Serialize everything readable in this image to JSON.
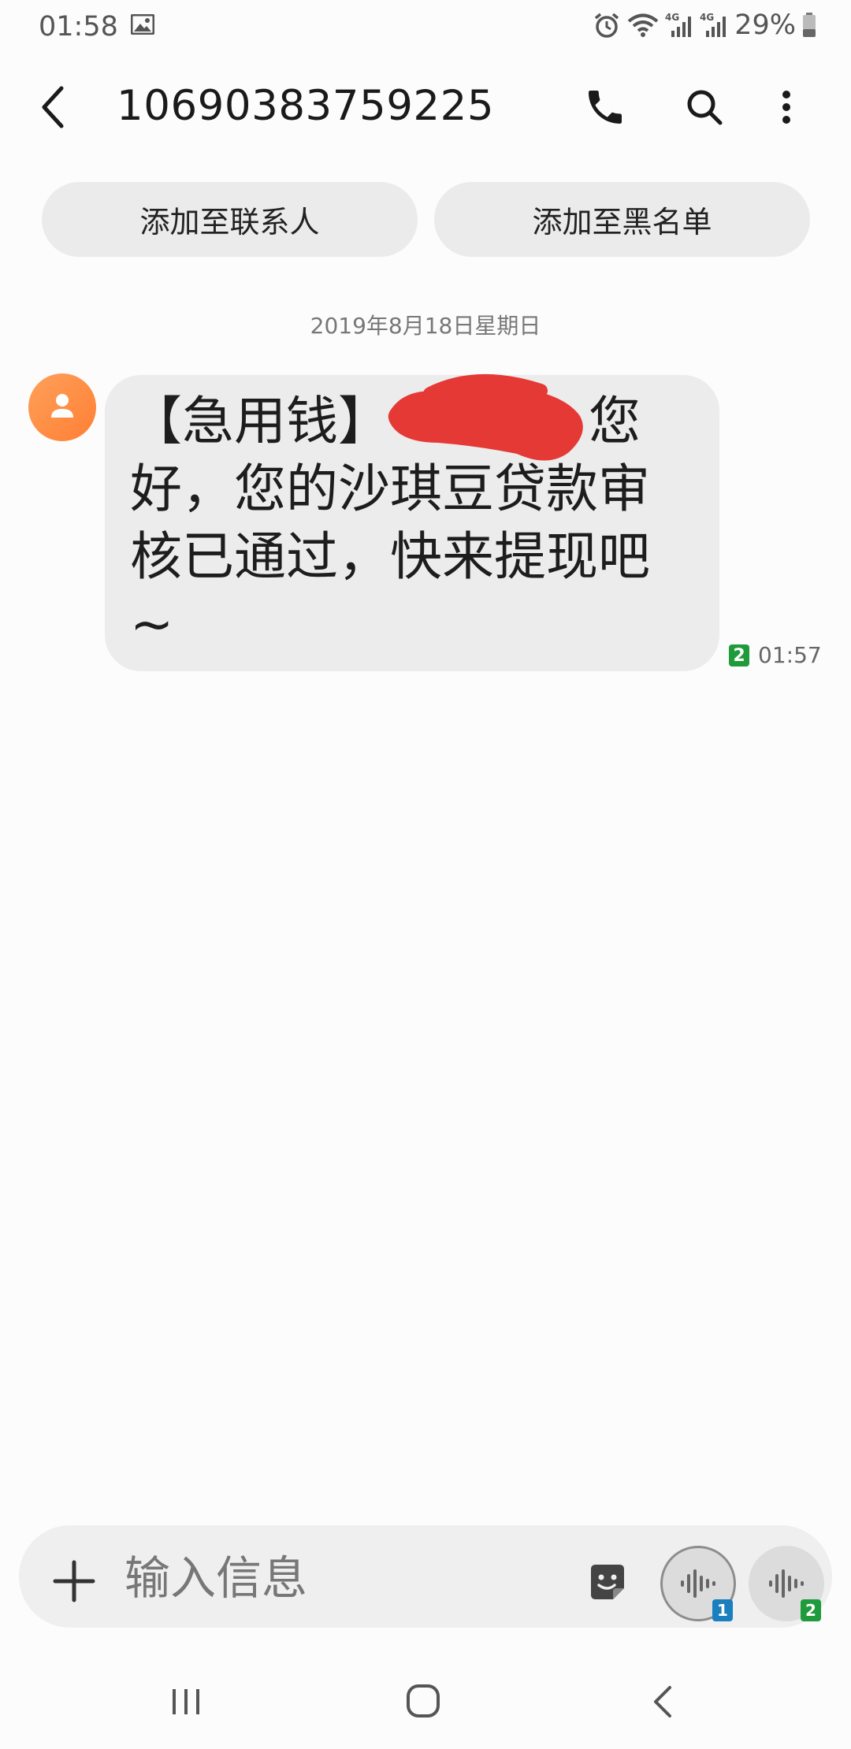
{
  "status_bar": {
    "time": "01:58",
    "battery_percent": "29%",
    "icons": [
      "gallery-icon",
      "alarm-icon",
      "wifi-icon",
      "signal-4g-icon",
      "signal-4g-icon",
      "battery-icon"
    ]
  },
  "app_bar": {
    "contact_number": "10690383759225",
    "icons": [
      "back-arrow-icon",
      "phone-icon",
      "search-icon",
      "more-vert-icon"
    ]
  },
  "actions": {
    "add_contact": "添加至联系人",
    "add_blocklist": "添加至黑名单"
  },
  "conversation": {
    "date": "2019年8月18日星期日",
    "messages": [
      {
        "text_line1": "【急用钱】",
        "text_line1_end": "您",
        "text_line2": "好，您的沙琪豆贷款审",
        "text_line3": "核已通过，快来提现吧",
        "text_line4": "~",
        "sim": "2",
        "time": "01:57"
      }
    ]
  },
  "composer": {
    "placeholder": "输入信息",
    "sim1_label": "1",
    "sim2_label": "2"
  },
  "colors": {
    "avatar": "#ff8a3d",
    "bubble": "#ececec",
    "redaction": "#e53935",
    "sim1": "#1a7fbf",
    "sim2": "#1f9b3b"
  }
}
